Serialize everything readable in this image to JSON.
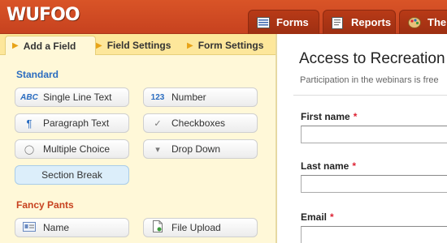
{
  "app": {
    "logo": "WUFOO"
  },
  "main_tabs": [
    {
      "label": "Forms",
      "icon": "forms-icon"
    },
    {
      "label": "Reports",
      "icon": "reports-icon"
    },
    {
      "label": "Themes",
      "icon": "themes-icon"
    }
  ],
  "sub_tabs": [
    {
      "label": "Add a Field",
      "active": true
    },
    {
      "label": "Field Settings"
    },
    {
      "label": "Form Settings"
    }
  ],
  "standard": {
    "title": "Standard",
    "fields": [
      {
        "label": "Single Line Text",
        "icon_text": "ABC"
      },
      {
        "label": "Number",
        "icon_text": "123"
      },
      {
        "label": "Paragraph Text",
        "icon_text": "¶"
      },
      {
        "label": "Checkboxes",
        "icon_text": "✓"
      },
      {
        "label": "Multiple Choice",
        "icon_text": "◯"
      },
      {
        "label": "Drop Down",
        "icon_text": "▾"
      },
      {
        "label": "Section Break"
      }
    ]
  },
  "fancy": {
    "title": "Fancy Pants",
    "fields": [
      {
        "label": "Name",
        "icon": "name-card-icon"
      },
      {
        "label": "File Upload",
        "icon": "file-upload-icon"
      }
    ]
  },
  "form": {
    "title": "Access to Recreation",
    "description": "Participation in the webinars is free",
    "fields": [
      {
        "label": "First name",
        "required_mark": "*"
      },
      {
        "label": "Last name",
        "required_mark": "*"
      },
      {
        "label": "Email",
        "required_mark": "*"
      }
    ]
  },
  "colors": {
    "brand": "#c7421f",
    "panel_bg": "#fff8d8",
    "subtab_bg": "#fde79b",
    "standard_title": "#2a6cc0"
  }
}
